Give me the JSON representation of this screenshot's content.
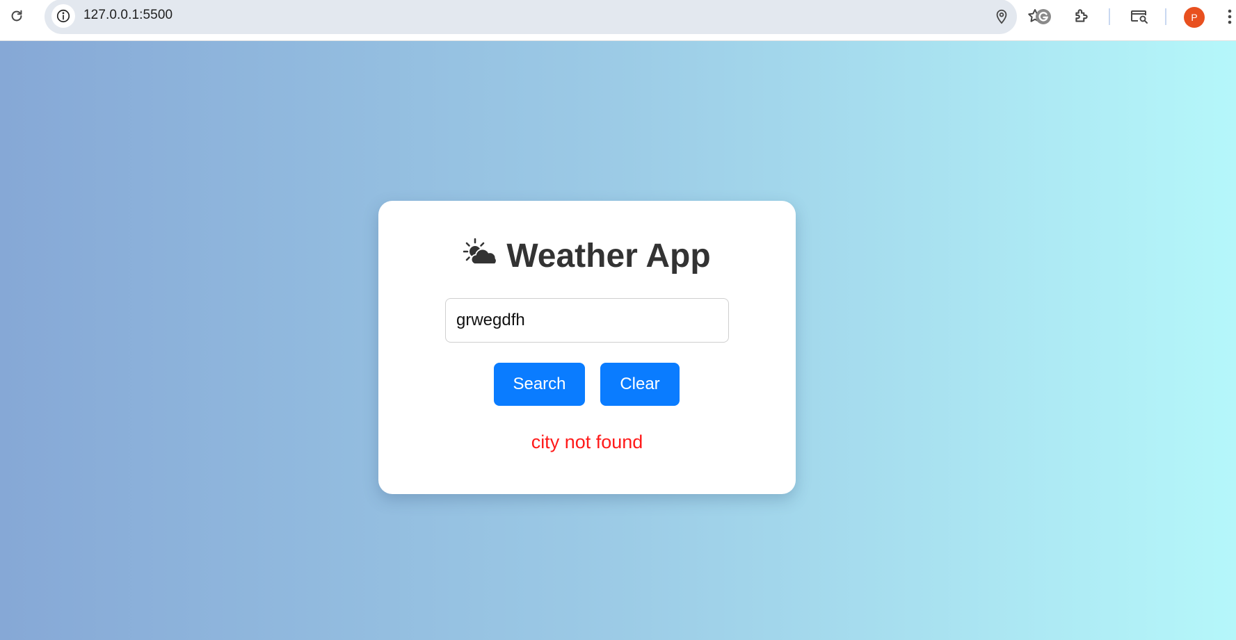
{
  "browser": {
    "url": "127.0.0.1:5500",
    "profile_initial": "P",
    "profile_color": "#e8501f",
    "icons": [
      "reload-icon",
      "site-info-icon",
      "location-icon",
      "bookmark-star-icon",
      "grammarly-icon",
      "extensions-icon",
      "tab-search-icon",
      "more-menu-icon"
    ]
  },
  "page": {
    "background_gradient": [
      "#86a8d6",
      "#b5f7fa"
    ]
  },
  "app": {
    "title": "Weather App",
    "title_icon": "sun-behind-cloud-icon",
    "search": {
      "value": "grwegdfh",
      "placeholder": ""
    },
    "buttons": {
      "search_label": "Search",
      "clear_label": "Clear",
      "color": "#0a7cff"
    },
    "error": {
      "message": "city not found",
      "color": "#ff1a1a"
    }
  }
}
